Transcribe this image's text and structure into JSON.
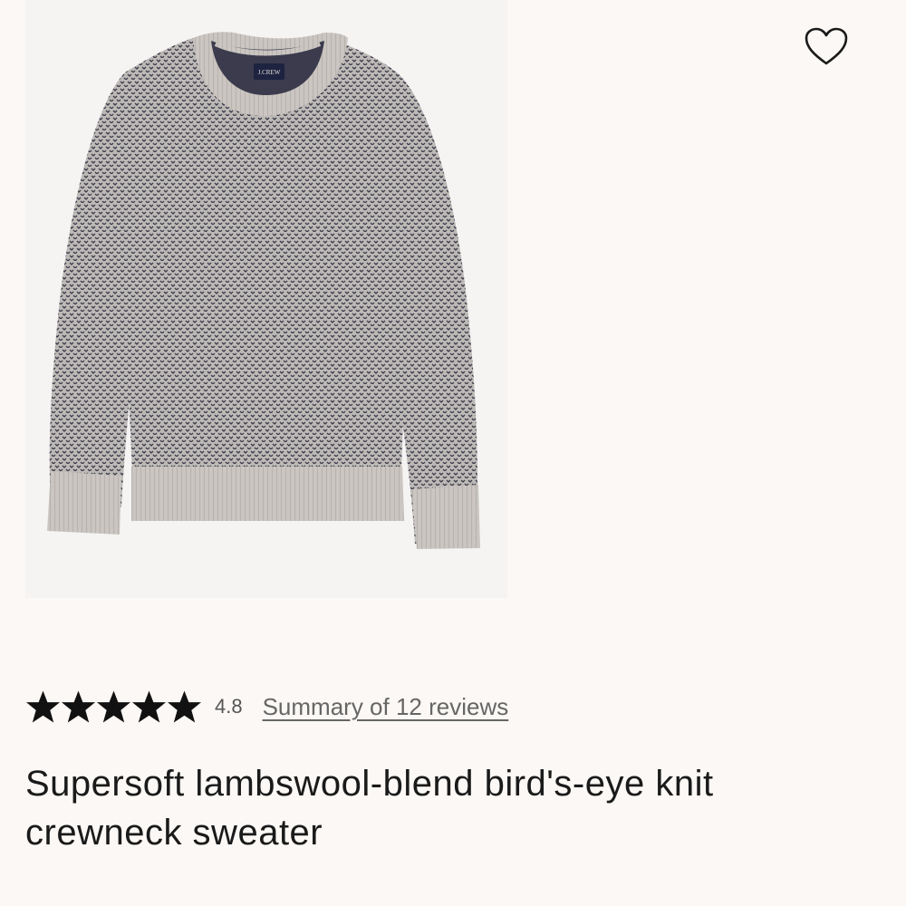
{
  "product": {
    "title": "Supersoft lambswool-blend bird's-eye knit crewneck sweater",
    "image_label": "J.CREW",
    "rating": {
      "stars": 5,
      "value": "4.8",
      "reviews_link": "Summary of 12 reviews"
    }
  },
  "icons": {
    "favorite": "heart-outline-icon",
    "star": "star-filled-icon"
  },
  "colors": {
    "background": "#fbf8f5",
    "image_background": "#f5f4f3",
    "sweater_base": "#b9b5b2",
    "sweater_trim": "#c9c4bf",
    "pattern_dot": "#3a3a4a",
    "text": "#1a1a1a",
    "muted_text": "#666666"
  }
}
